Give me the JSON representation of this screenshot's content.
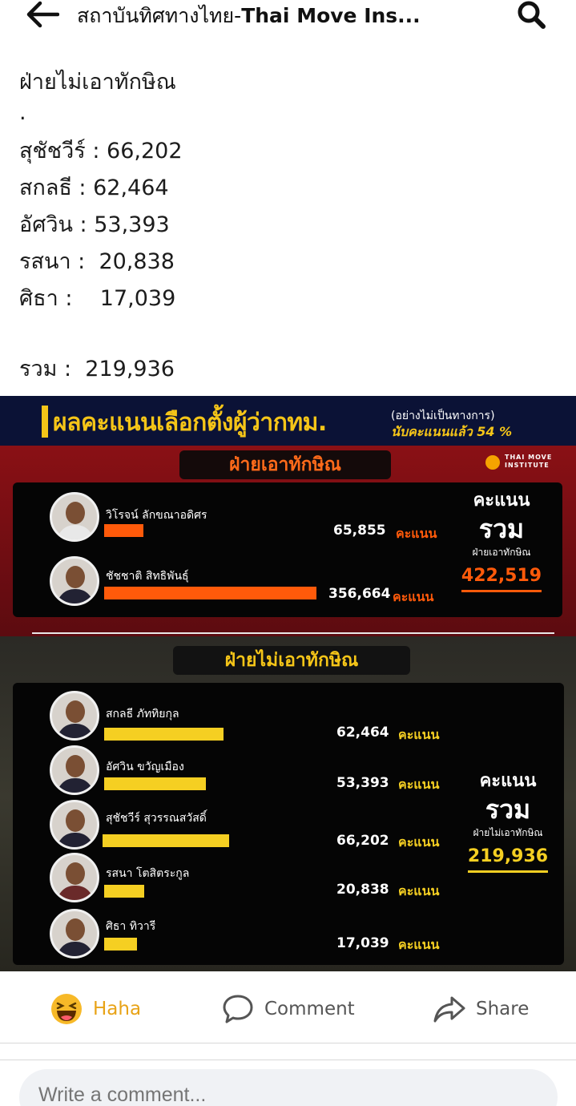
{
  "topbar": {
    "title_thai": "สถาบันทิศทางไทย-",
    "title_bold": "Thai Move Ins...",
    "back_icon": "arrow-left-icon",
    "search_icon": "search-icon"
  },
  "post": {
    "heading": "ฝ่ายไม่เอาทักษิณ",
    "dot": ".",
    "lines": [
      "สุชัชวีร์ : 66,202",
      "สกลธี : 62,464",
      "อัศวิน : 53,393",
      "รสนา :  20,838",
      "ศิธา :    17,039"
    ],
    "total_line": "รวม :  219,936"
  },
  "infographic": {
    "title": "ผลคะแนนเลือกตั้งผู้ว่ากทม.",
    "note": "(อย่างไม่เป็นทางการ)",
    "count_prefix": "นับคะแนนแล้ว",
    "count_percent": "54 %",
    "logo_line1": "THAI MOVE",
    "logo_line2": "INSTITUTE",
    "unit": "คะแนน",
    "pro_side": {
      "label": "ฝ่ายเอาทักษิณ",
      "total_label1": "คะแนน",
      "total_label2": "รวม",
      "total_label3": "ฝ่ายเอาทักษิณ",
      "total": "422,519",
      "candidates": [
        {
          "name": "วิโรจน์ ลักขณาอดิศร",
          "votes": "65,855",
          "share": 0.185
        },
        {
          "name": "ชัชชาติ สิทธิพันธุ์",
          "votes": "356,664",
          "share": 1.0
        }
      ]
    },
    "anti_side": {
      "label": "ฝ่ายไม่เอาทักษิณ",
      "total_label1": "คะแนน",
      "total_label2": "รวม",
      "total_label3": "ฝ่ายไม่เอาทักษิณ",
      "total": "219,936",
      "candidates": [
        {
          "name": "สกลธี ภัททิยกุล",
          "votes": "62,464",
          "share": 0.944
        },
        {
          "name": "อัศวิน ขวัญเมือง",
          "votes": "53,393",
          "share": 0.806
        },
        {
          "name": "สุชัชวีร์ สุวรรณสวัสดิ์",
          "votes": "66,202",
          "share": 1.0
        },
        {
          "name": "รสนา โตสิตระกูล",
          "votes": "20,838",
          "share": 0.315
        },
        {
          "name": "ศิธา ทิวารี",
          "votes": "17,039",
          "share": 0.257
        }
      ]
    },
    "colors": {
      "pro": "#ff5a0a",
      "anti": "#f5cf22",
      "header": "#0b1236"
    }
  },
  "actions": {
    "haha_label": "Haha",
    "haha_icon": "haha-emoji-icon",
    "comment_label": "Comment",
    "comment_icon": "comment-bubble-icon",
    "share_label": "Share",
    "share_icon": "share-arrow-icon"
  },
  "comment": {
    "placeholder": "Write a comment..."
  }
}
